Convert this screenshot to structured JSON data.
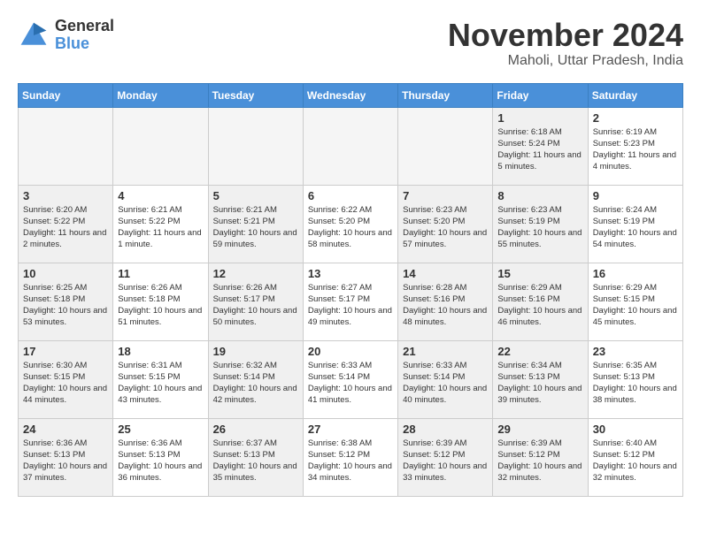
{
  "header": {
    "logo_general": "General",
    "logo_blue": "Blue",
    "month_title": "November 2024",
    "location": "Maholi, Uttar Pradesh, India"
  },
  "weekdays": [
    "Sunday",
    "Monday",
    "Tuesday",
    "Wednesday",
    "Thursday",
    "Friday",
    "Saturday"
  ],
  "weeks": [
    [
      {
        "day": "",
        "info": "",
        "empty": true
      },
      {
        "day": "",
        "info": "",
        "empty": true
      },
      {
        "day": "",
        "info": "",
        "empty": true
      },
      {
        "day": "",
        "info": "",
        "empty": true
      },
      {
        "day": "",
        "info": "",
        "empty": true
      },
      {
        "day": "1",
        "info": "Sunrise: 6:18 AM\nSunset: 5:24 PM\nDaylight: 11 hours and 5 minutes.",
        "shaded": true
      },
      {
        "day": "2",
        "info": "Sunrise: 6:19 AM\nSunset: 5:23 PM\nDaylight: 11 hours and 4 minutes.",
        "shaded": false
      }
    ],
    [
      {
        "day": "3",
        "info": "Sunrise: 6:20 AM\nSunset: 5:22 PM\nDaylight: 11 hours and 2 minutes.",
        "shaded": true
      },
      {
        "day": "4",
        "info": "Sunrise: 6:21 AM\nSunset: 5:22 PM\nDaylight: 11 hours and 1 minute.",
        "shaded": false
      },
      {
        "day": "5",
        "info": "Sunrise: 6:21 AM\nSunset: 5:21 PM\nDaylight: 10 hours and 59 minutes.",
        "shaded": true
      },
      {
        "day": "6",
        "info": "Sunrise: 6:22 AM\nSunset: 5:20 PM\nDaylight: 10 hours and 58 minutes.",
        "shaded": false
      },
      {
        "day": "7",
        "info": "Sunrise: 6:23 AM\nSunset: 5:20 PM\nDaylight: 10 hours and 57 minutes.",
        "shaded": true
      },
      {
        "day": "8",
        "info": "Sunrise: 6:23 AM\nSunset: 5:19 PM\nDaylight: 10 hours and 55 minutes.",
        "shaded": true
      },
      {
        "day": "9",
        "info": "Sunrise: 6:24 AM\nSunset: 5:19 PM\nDaylight: 10 hours and 54 minutes.",
        "shaded": false
      }
    ],
    [
      {
        "day": "10",
        "info": "Sunrise: 6:25 AM\nSunset: 5:18 PM\nDaylight: 10 hours and 53 minutes.",
        "shaded": true
      },
      {
        "day": "11",
        "info": "Sunrise: 6:26 AM\nSunset: 5:18 PM\nDaylight: 10 hours and 51 minutes.",
        "shaded": false
      },
      {
        "day": "12",
        "info": "Sunrise: 6:26 AM\nSunset: 5:17 PM\nDaylight: 10 hours and 50 minutes.",
        "shaded": true
      },
      {
        "day": "13",
        "info": "Sunrise: 6:27 AM\nSunset: 5:17 PM\nDaylight: 10 hours and 49 minutes.",
        "shaded": false
      },
      {
        "day": "14",
        "info": "Sunrise: 6:28 AM\nSunset: 5:16 PM\nDaylight: 10 hours and 48 minutes.",
        "shaded": true
      },
      {
        "day": "15",
        "info": "Sunrise: 6:29 AM\nSunset: 5:16 PM\nDaylight: 10 hours and 46 minutes.",
        "shaded": true
      },
      {
        "day": "16",
        "info": "Sunrise: 6:29 AM\nSunset: 5:15 PM\nDaylight: 10 hours and 45 minutes.",
        "shaded": false
      }
    ],
    [
      {
        "day": "17",
        "info": "Sunrise: 6:30 AM\nSunset: 5:15 PM\nDaylight: 10 hours and 44 minutes.",
        "shaded": true
      },
      {
        "day": "18",
        "info": "Sunrise: 6:31 AM\nSunset: 5:15 PM\nDaylight: 10 hours and 43 minutes.",
        "shaded": false
      },
      {
        "day": "19",
        "info": "Sunrise: 6:32 AM\nSunset: 5:14 PM\nDaylight: 10 hours and 42 minutes.",
        "shaded": true
      },
      {
        "day": "20",
        "info": "Sunrise: 6:33 AM\nSunset: 5:14 PM\nDaylight: 10 hours and 41 minutes.",
        "shaded": false
      },
      {
        "day": "21",
        "info": "Sunrise: 6:33 AM\nSunset: 5:14 PM\nDaylight: 10 hours and 40 minutes.",
        "shaded": true
      },
      {
        "day": "22",
        "info": "Sunrise: 6:34 AM\nSunset: 5:13 PM\nDaylight: 10 hours and 39 minutes.",
        "shaded": true
      },
      {
        "day": "23",
        "info": "Sunrise: 6:35 AM\nSunset: 5:13 PM\nDaylight: 10 hours and 38 minutes.",
        "shaded": false
      }
    ],
    [
      {
        "day": "24",
        "info": "Sunrise: 6:36 AM\nSunset: 5:13 PM\nDaylight: 10 hours and 37 minutes.",
        "shaded": true
      },
      {
        "day": "25",
        "info": "Sunrise: 6:36 AM\nSunset: 5:13 PM\nDaylight: 10 hours and 36 minutes.",
        "shaded": false
      },
      {
        "day": "26",
        "info": "Sunrise: 6:37 AM\nSunset: 5:13 PM\nDaylight: 10 hours and 35 minutes.",
        "shaded": true
      },
      {
        "day": "27",
        "info": "Sunrise: 6:38 AM\nSunset: 5:12 PM\nDaylight: 10 hours and 34 minutes.",
        "shaded": false
      },
      {
        "day": "28",
        "info": "Sunrise: 6:39 AM\nSunset: 5:12 PM\nDaylight: 10 hours and 33 minutes.",
        "shaded": true
      },
      {
        "day": "29",
        "info": "Sunrise: 6:39 AM\nSunset: 5:12 PM\nDaylight: 10 hours and 32 minutes.",
        "shaded": true
      },
      {
        "day": "30",
        "info": "Sunrise: 6:40 AM\nSunset: 5:12 PM\nDaylight: 10 hours and 32 minutes.",
        "shaded": false
      }
    ]
  ]
}
